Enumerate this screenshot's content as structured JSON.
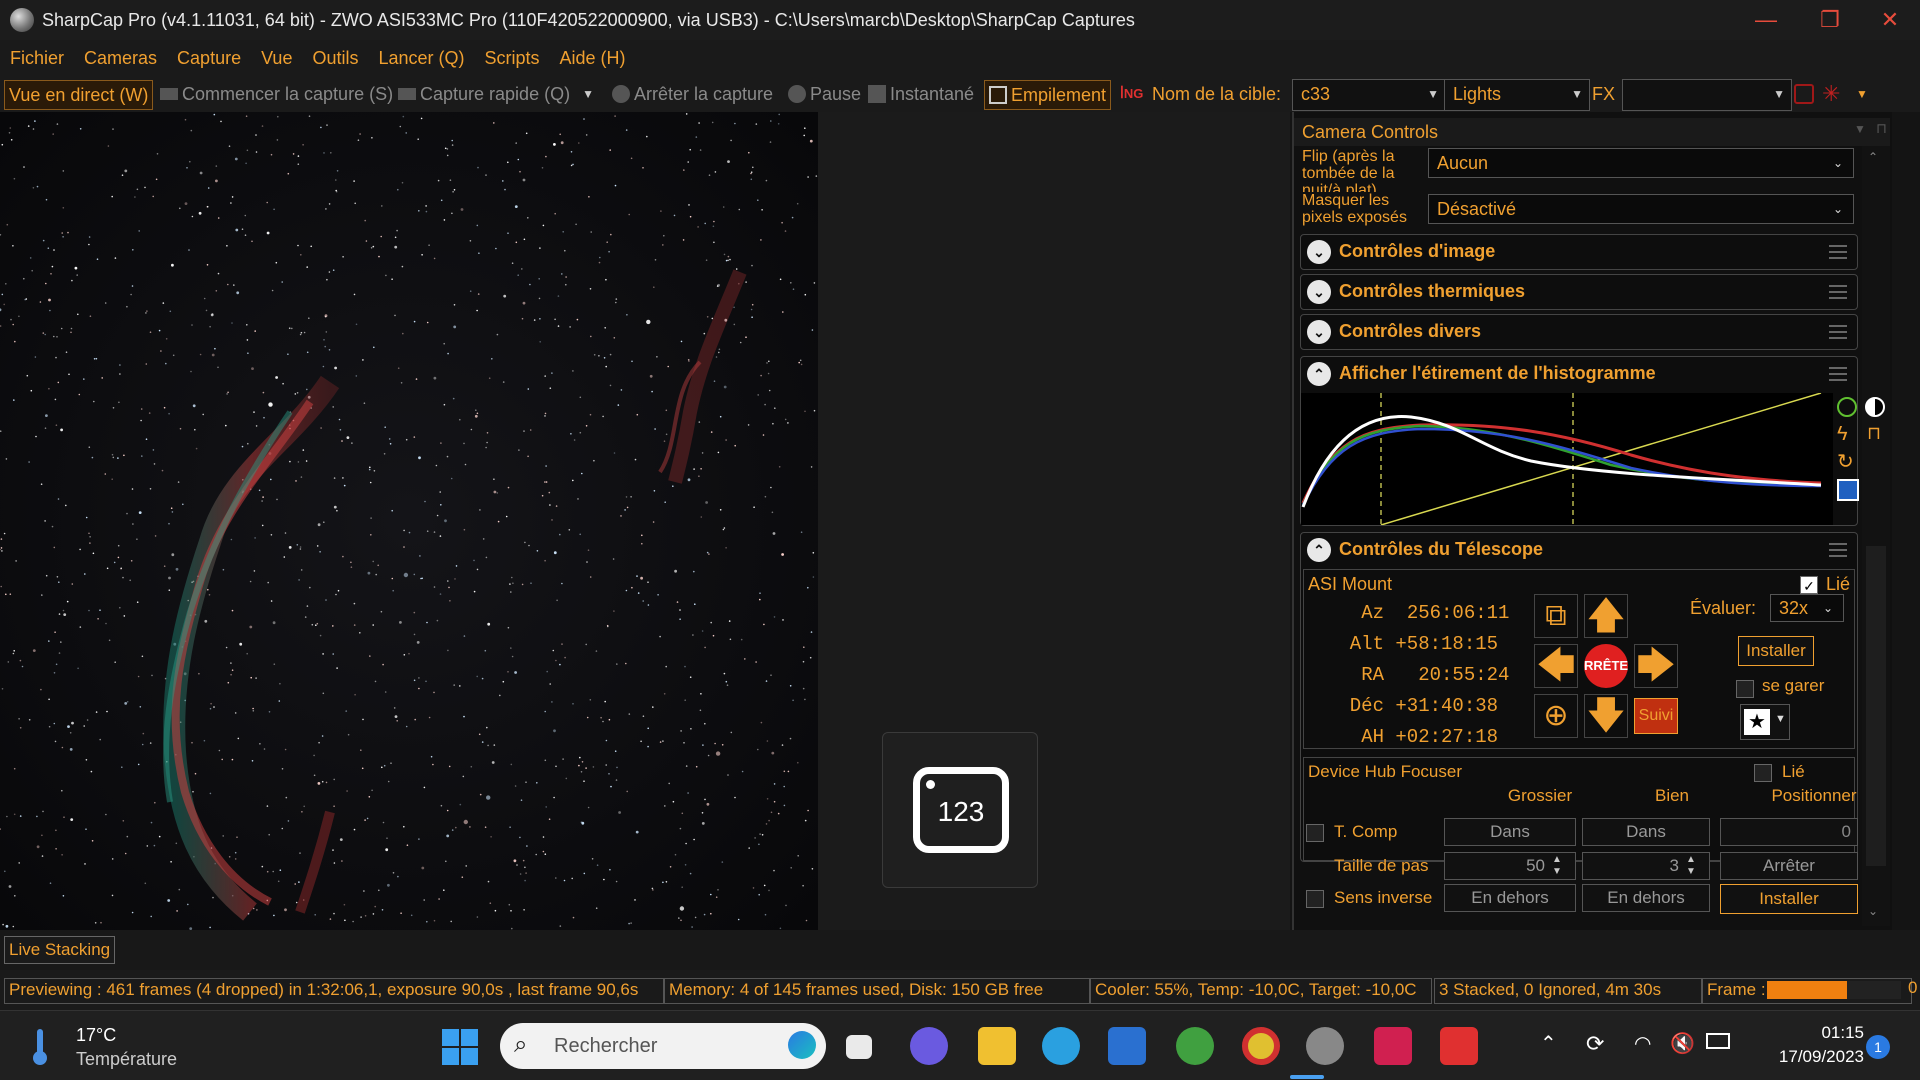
{
  "window": {
    "title": "SharpCap Pro (v4.1.11031, 64 bit) - ZWO ASI533MC Pro (110F420522000900, via USB3) - C:\\Users\\marcb\\Desktop\\SharpCap Captures",
    "minimize_icon": "minimize-icon",
    "restore_icon": "restore-icon",
    "close_icon": "close-icon"
  },
  "menu": [
    "Fichier",
    "Cameras",
    "Capture",
    "Vue",
    "Outils",
    "Lancer (Q)",
    "Scripts",
    "Aide (H)"
  ],
  "toolbar": {
    "live_view": "Vue en direct (W)",
    "start_capture": "Commencer la capture (S)",
    "quick_capture": "Capture rapide (Q)",
    "stop_capture": "Arrêter la capture",
    "pause": "Pause",
    "snapshot": "Instantané",
    "stacking": "Empilement",
    "target_label": "Nom de la cible:",
    "target_value": "c33",
    "frame_type": "Lights",
    "fx_label": "FX",
    "fx_value": ""
  },
  "panel": {
    "title": "Camera Controls",
    "flip_label": "Flip (après la tombée de la nuit/à plat)",
    "flip_value": "Aucun",
    "mask_label": "Masquer les pixels exposés",
    "mask_value": "Désactivé",
    "sections": {
      "image": "Contrôles d'image",
      "thermal": "Contrôles thermiques",
      "misc": "Contrôles divers",
      "histogram": "Afficher l'étirement de l'histogramme",
      "telescope": "Contrôles du Télescope"
    },
    "mount": {
      "name": "ASI Mount",
      "linked_label": "Lié",
      "linked": true,
      "coords": [
        {
          "label": "Az",
          "value": "256:06:11"
        },
        {
          "label": "Alt",
          "value": "+58:18:15"
        },
        {
          "label": "RA",
          "value": "20:55:24"
        },
        {
          "label": "Déc",
          "value": "+31:40:38"
        },
        {
          "label": "AH",
          "value": "+02:27:18"
        }
      ],
      "rate_label": "Évaluer:",
      "rate_value": "32x",
      "stop_label": "RRÊTE",
      "install_label": "Installer",
      "park_label": "se garer",
      "track_label": "Suivi"
    },
    "focuser": {
      "name": "Device Hub Focuser",
      "linked_label": "Lié",
      "linked": false,
      "col_coarse": "Grossier",
      "col_fine": "Bien",
      "col_position": "Positionner",
      "tcomp_label": "T. Comp",
      "in_label": "Dans",
      "position_value": "0",
      "step_label": "Taille de pas",
      "coarse_step": "50",
      "fine_step": "3",
      "stop_label": "Arrêter",
      "reverse_label": "Sens inverse",
      "out_label": "En dehors",
      "install_label": "Installer"
    }
  },
  "live_stacking_tab": "Live Stacking",
  "status": {
    "preview": "Previewing : 461 frames (4 dropped) in 1:32:06,1, exposure 90,0s , last frame 90,6s",
    "memory": "Memory: 4 of 145 frames used, Disk: 150 GB free",
    "cooler": "Cooler: 55%, Temp: -10,0C, Target: -10,0C",
    "stacked": "3 Stacked, 0 Ignored, 4m 30s",
    "frame_label": "Frame :",
    "frame_progress": 0.6,
    "tail": "0"
  },
  "keyboard_tile": {
    "text": "123"
  },
  "taskbar": {
    "weather_temp": "17°C",
    "weather_label": "Température",
    "search_placeholder": "Rechercher",
    "time": "01:15",
    "date": "17/09/2023",
    "notification_count": "1"
  },
  "colors": {
    "accent": "#f0a030",
    "stop_red": "#e02020"
  }
}
